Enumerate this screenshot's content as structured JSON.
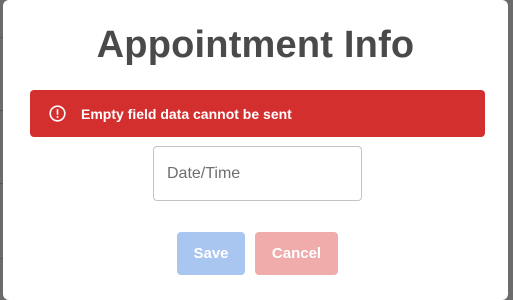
{
  "dialog": {
    "title": "Appointment Info"
  },
  "alert": {
    "icon": "error-circle-icon",
    "message": "Empty field data cannot be sent",
    "color": "#d32f2f"
  },
  "datetime_field": {
    "value": "",
    "placeholder": "Date/Time"
  },
  "buttons": {
    "save_label": "Save",
    "cancel_label": "Cancel",
    "save_color": "#a9c6f0",
    "cancel_color": "#f0abab"
  }
}
